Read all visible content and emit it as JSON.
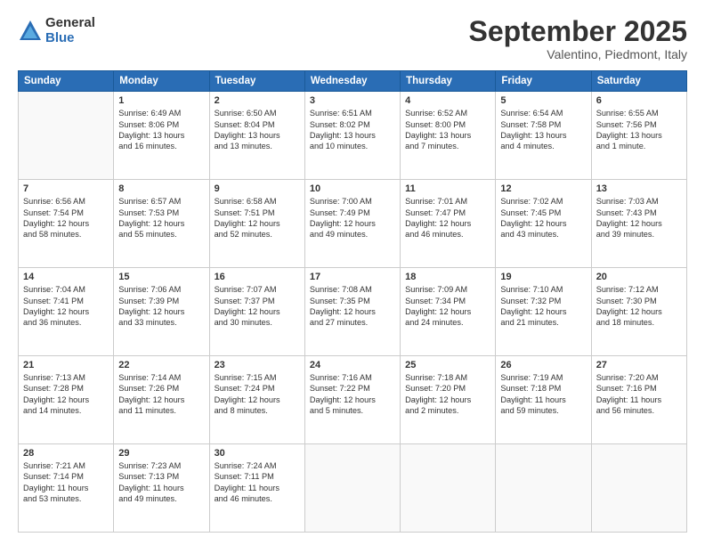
{
  "header": {
    "logo_general": "General",
    "logo_blue": "Blue",
    "month_title": "September 2025",
    "location": "Valentino, Piedmont, Italy"
  },
  "weekdays": [
    "Sunday",
    "Monday",
    "Tuesday",
    "Wednesday",
    "Thursday",
    "Friday",
    "Saturday"
  ],
  "weeks": [
    [
      {
        "day": "",
        "info": ""
      },
      {
        "day": "1",
        "info": "Sunrise: 6:49 AM\nSunset: 8:06 PM\nDaylight: 13 hours\nand 16 minutes."
      },
      {
        "day": "2",
        "info": "Sunrise: 6:50 AM\nSunset: 8:04 PM\nDaylight: 13 hours\nand 13 minutes."
      },
      {
        "day": "3",
        "info": "Sunrise: 6:51 AM\nSunset: 8:02 PM\nDaylight: 13 hours\nand 10 minutes."
      },
      {
        "day": "4",
        "info": "Sunrise: 6:52 AM\nSunset: 8:00 PM\nDaylight: 13 hours\nand 7 minutes."
      },
      {
        "day": "5",
        "info": "Sunrise: 6:54 AM\nSunset: 7:58 PM\nDaylight: 13 hours\nand 4 minutes."
      },
      {
        "day": "6",
        "info": "Sunrise: 6:55 AM\nSunset: 7:56 PM\nDaylight: 13 hours\nand 1 minute."
      }
    ],
    [
      {
        "day": "7",
        "info": "Sunrise: 6:56 AM\nSunset: 7:54 PM\nDaylight: 12 hours\nand 58 minutes."
      },
      {
        "day": "8",
        "info": "Sunrise: 6:57 AM\nSunset: 7:53 PM\nDaylight: 12 hours\nand 55 minutes."
      },
      {
        "day": "9",
        "info": "Sunrise: 6:58 AM\nSunset: 7:51 PM\nDaylight: 12 hours\nand 52 minutes."
      },
      {
        "day": "10",
        "info": "Sunrise: 7:00 AM\nSunset: 7:49 PM\nDaylight: 12 hours\nand 49 minutes."
      },
      {
        "day": "11",
        "info": "Sunrise: 7:01 AM\nSunset: 7:47 PM\nDaylight: 12 hours\nand 46 minutes."
      },
      {
        "day": "12",
        "info": "Sunrise: 7:02 AM\nSunset: 7:45 PM\nDaylight: 12 hours\nand 43 minutes."
      },
      {
        "day": "13",
        "info": "Sunrise: 7:03 AM\nSunset: 7:43 PM\nDaylight: 12 hours\nand 39 minutes."
      }
    ],
    [
      {
        "day": "14",
        "info": "Sunrise: 7:04 AM\nSunset: 7:41 PM\nDaylight: 12 hours\nand 36 minutes."
      },
      {
        "day": "15",
        "info": "Sunrise: 7:06 AM\nSunset: 7:39 PM\nDaylight: 12 hours\nand 33 minutes."
      },
      {
        "day": "16",
        "info": "Sunrise: 7:07 AM\nSunset: 7:37 PM\nDaylight: 12 hours\nand 30 minutes."
      },
      {
        "day": "17",
        "info": "Sunrise: 7:08 AM\nSunset: 7:35 PM\nDaylight: 12 hours\nand 27 minutes."
      },
      {
        "day": "18",
        "info": "Sunrise: 7:09 AM\nSunset: 7:34 PM\nDaylight: 12 hours\nand 24 minutes."
      },
      {
        "day": "19",
        "info": "Sunrise: 7:10 AM\nSunset: 7:32 PM\nDaylight: 12 hours\nand 21 minutes."
      },
      {
        "day": "20",
        "info": "Sunrise: 7:12 AM\nSunset: 7:30 PM\nDaylight: 12 hours\nand 18 minutes."
      }
    ],
    [
      {
        "day": "21",
        "info": "Sunrise: 7:13 AM\nSunset: 7:28 PM\nDaylight: 12 hours\nand 14 minutes."
      },
      {
        "day": "22",
        "info": "Sunrise: 7:14 AM\nSunset: 7:26 PM\nDaylight: 12 hours\nand 11 minutes."
      },
      {
        "day": "23",
        "info": "Sunrise: 7:15 AM\nSunset: 7:24 PM\nDaylight: 12 hours\nand 8 minutes."
      },
      {
        "day": "24",
        "info": "Sunrise: 7:16 AM\nSunset: 7:22 PM\nDaylight: 12 hours\nand 5 minutes."
      },
      {
        "day": "25",
        "info": "Sunrise: 7:18 AM\nSunset: 7:20 PM\nDaylight: 12 hours\nand 2 minutes."
      },
      {
        "day": "26",
        "info": "Sunrise: 7:19 AM\nSunset: 7:18 PM\nDaylight: 11 hours\nand 59 minutes."
      },
      {
        "day": "27",
        "info": "Sunrise: 7:20 AM\nSunset: 7:16 PM\nDaylight: 11 hours\nand 56 minutes."
      }
    ],
    [
      {
        "day": "28",
        "info": "Sunrise: 7:21 AM\nSunset: 7:14 PM\nDaylight: 11 hours\nand 53 minutes."
      },
      {
        "day": "29",
        "info": "Sunrise: 7:23 AM\nSunset: 7:13 PM\nDaylight: 11 hours\nand 49 minutes."
      },
      {
        "day": "30",
        "info": "Sunrise: 7:24 AM\nSunset: 7:11 PM\nDaylight: 11 hours\nand 46 minutes."
      },
      {
        "day": "",
        "info": ""
      },
      {
        "day": "",
        "info": ""
      },
      {
        "day": "",
        "info": ""
      },
      {
        "day": "",
        "info": ""
      }
    ]
  ]
}
